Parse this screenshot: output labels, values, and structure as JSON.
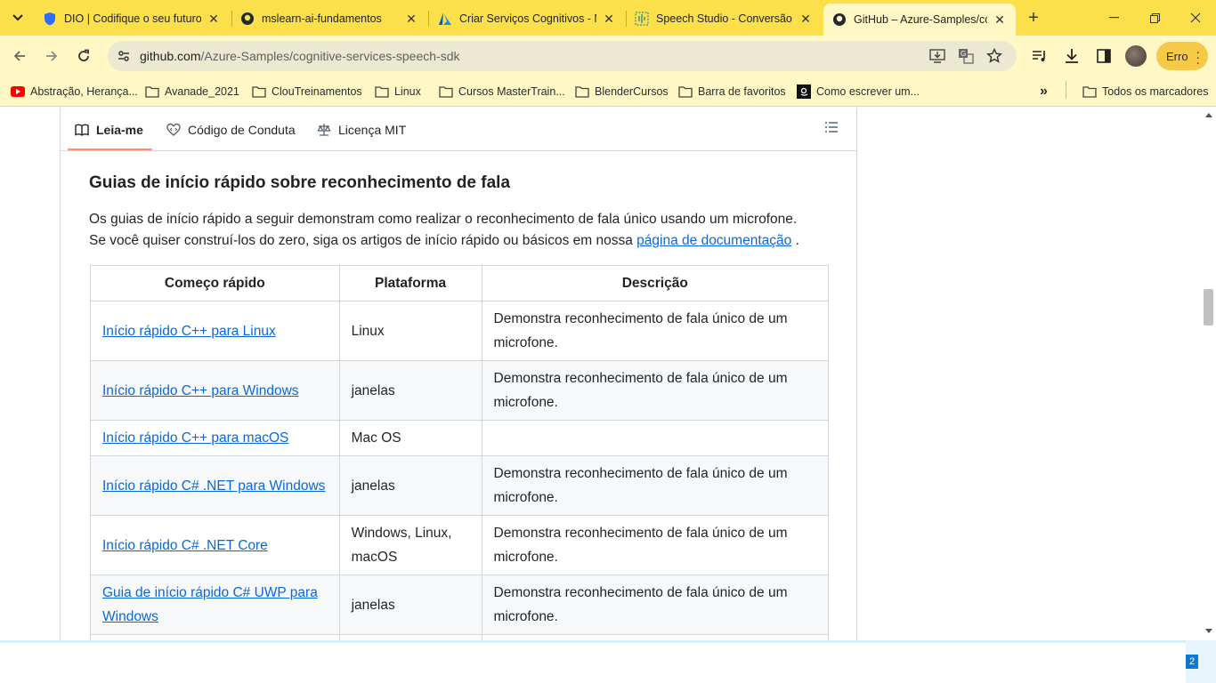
{
  "browser": {
    "tabs": [
      {
        "title": "DIO | Codifique o seu futuro",
        "icon": "dio-shield-icon",
        "active": false
      },
      {
        "title": "mslearn-ai-fundamentos",
        "icon": "github-icon",
        "active": false
      },
      {
        "title": "Criar Serviços Cognitivos - M",
        "icon": "azure-icon",
        "active": false
      },
      {
        "title": "Speech Studio - Conversão d",
        "icon": "speech-studio-icon",
        "active": false
      },
      {
        "title": "GitHub – Azure-Samples/cog",
        "icon": "github-icon",
        "active": true
      }
    ],
    "url_domain": "github.com",
    "url_path": "/Azure-Samples/cognitive-services-speech-sdk",
    "profile_error_label": "Erro",
    "bookmarks": [
      {
        "label": "Abstração, Herança...",
        "icon": "youtube-icon"
      },
      {
        "label": "Avanade_2021",
        "icon": "folder-icon"
      },
      {
        "label": "ClouTreinamentos",
        "icon": "folder-icon"
      },
      {
        "label": "Linux",
        "icon": "folder-icon"
      },
      {
        "label": "Cursos MasterTrain...",
        "icon": "folder-icon"
      },
      {
        "label": "BlenderCursos",
        "icon": "folder-icon"
      },
      {
        "label": "Barra de favoritos",
        "icon": "folder-icon"
      },
      {
        "label": "Como escrever um...",
        "icon": "amazon-icon"
      }
    ],
    "all_bookmarks_label": "Todos os marcadores",
    "accent_color": "#fbe04c"
  },
  "readme": {
    "tabs": [
      {
        "label": "Leia-me",
        "icon": "book-icon",
        "active": true
      },
      {
        "label": "Código de Conduta",
        "icon": "heart-code-icon",
        "active": false
      },
      {
        "label": "Licença MIT",
        "icon": "scale-icon",
        "active": false
      }
    ],
    "heading": "Guias de início rápido sobre reconhecimento de fala",
    "paragraph_line1": "Os guias de início rápido a seguir demonstram como realizar o reconhecimento de fala único usando um microfone.",
    "paragraph_line2_before": "Se você quiser construí-los do zero, siga os artigos de início rápido ou básicos em nossa",
    "paragraph_link": "página de documentação",
    "paragraph_after": ".",
    "table": {
      "headers": [
        "Começo rápido",
        "Plataforma",
        "Descrição"
      ],
      "rows": [
        {
          "quickstart": "Início rápido C++ para Linux",
          "platform": "Linux",
          "description": "Demonstra reconhecimento de fala único de um microfone."
        },
        {
          "quickstart": "Início rápido C++ para Windows",
          "platform": "janelas",
          "description": "Demonstra reconhecimento de fala único de um microfone."
        },
        {
          "quickstart": "Início rápido C++ para macOS",
          "platform": "Mac OS",
          "description": ""
        },
        {
          "quickstart": "Início rápido C# .NET para Windows",
          "platform": "janelas",
          "description": "Demonstra reconhecimento de fala único de um microfone."
        },
        {
          "quickstart": "Início rápido C# .NET Core",
          "platform": "Windows, Linux, macOS",
          "description": "Demonstra reconhecimento de fala único de um microfone."
        },
        {
          "quickstart": "Guia de início rápido C# UWP para Windows",
          "platform": "janelas",
          "description": "Demonstra reconhecimento de fala único de um microfone."
        }
      ]
    }
  },
  "taskbar": {
    "badge_count": "2"
  }
}
